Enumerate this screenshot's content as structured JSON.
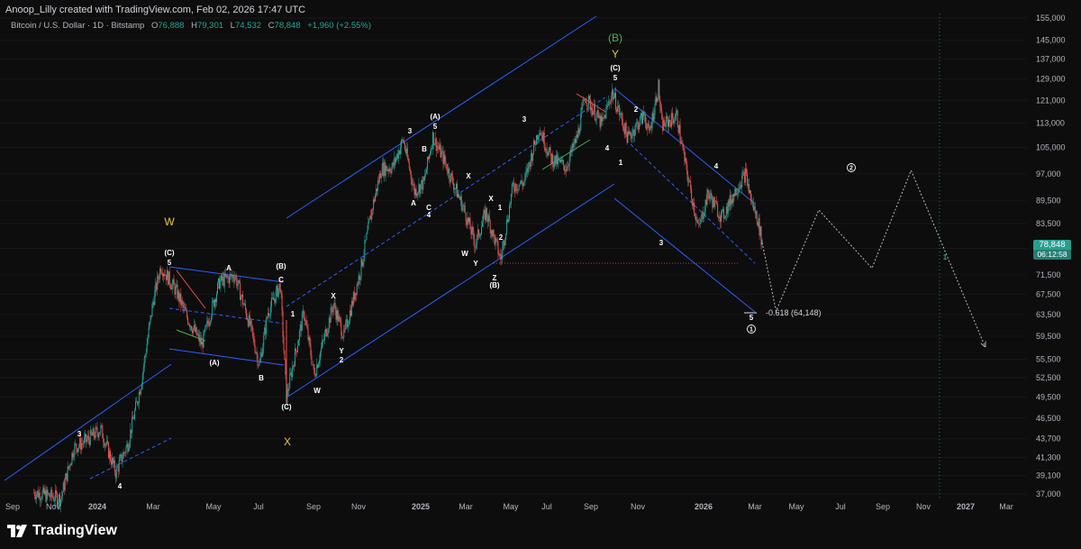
{
  "header": {
    "text": "Anoop_Lilly created with TradingView.com, Feb 02, 2026 17:47 UTC"
  },
  "symbol": {
    "name": "Bitcoin / U.S. Dollar · 1D · Bitstamp",
    "o_label": "O",
    "o": "76,888",
    "h_label": "H",
    "h": "79,301",
    "l_label": "L",
    "l": "74,532",
    "c_label": "C",
    "c": "78,848",
    "change": "+1,960 (+2.55%)"
  },
  "last_price": {
    "value": "78,848",
    "countdown": "06:12:58"
  },
  "fib_label": "-0.618 (64,148)",
  "footer": {
    "brand": "TradingView"
  },
  "colors": {
    "up": "#26a69a",
    "down": "#ef5350",
    "channel": "#2962ff",
    "wave_green": "#4caf50",
    "wave_yellow": "#e8c547",
    "background": "#0d0d0d"
  },
  "chart_data": {
    "type": "candlestick",
    "title": "Bitcoin / U.S. Dollar · 1D · Bitstamp",
    "y_axis_ticks": [
      "155,000",
      "145,000",
      "137,000",
      "129,000",
      "121,000",
      "113,000",
      "105,000",
      "97,000",
      "89,500",
      "83,500",
      "77,500",
      "71,500",
      "67,500",
      "63,500",
      "59,500",
      "55,500",
      "52,500",
      "49,500",
      "46,500",
      "43,700",
      "41,300",
      "39,100",
      "37,000"
    ],
    "x_axis_ticks": [
      "Sep",
      "Nov",
      "2024",
      "Mar",
      "May",
      "Jul",
      "Sep",
      "Nov",
      "2025",
      "Mar",
      "May",
      "Jul",
      "Sep",
      "Nov",
      "2026",
      "Mar",
      "May",
      "Jul",
      "Sep",
      "Nov",
      "2027",
      "Mar"
    ],
    "yscale": "log",
    "ylim": [
      37000,
      155000
    ],
    "close_path": [
      [
        "2023-10-20",
        37200
      ],
      [
        "2023-11-20",
        36500
      ],
      [
        "2023-12-05",
        42500
      ],
      [
        "2023-12-20",
        43500
      ],
      [
        "2024-01-05",
        45000
      ],
      [
        "2024-01-22",
        39500
      ],
      [
        "2024-02-05",
        43000
      ],
      [
        "2024-02-20",
        51500
      ],
      [
        "2024-03-05",
        66000
      ],
      [
        "2024-03-14",
        73500
      ],
      [
        "2024-04-01",
        68000
      ],
      [
        "2024-04-13",
        63000
      ],
      [
        "2024-04-30",
        58000
      ],
      [
        "2024-05-20",
        70000
      ],
      [
        "2024-06-07",
        71500
      ],
      [
        "2024-06-25",
        61000
      ],
      [
        "2024-07-05",
        54500
      ],
      [
        "2024-07-15",
        64000
      ],
      [
        "2024-07-29",
        69500
      ],
      [
        "2024-08-05",
        49500
      ],
      [
        "2024-08-25",
        64000
      ],
      [
        "2024-09-06",
        53000
      ],
      [
        "2024-09-28",
        65500
      ],
      [
        "2024-10-10",
        59500
      ],
      [
        "2024-10-29",
        72500
      ],
      [
        "2024-11-12",
        88000
      ],
      [
        "2024-11-22",
        98500
      ],
      [
        "2024-12-05",
        99000
      ],
      [
        "2024-12-17",
        107500
      ],
      [
        "2024-12-30",
        92000
      ],
      [
        "2025-01-10",
        94500
      ],
      [
        "2025-01-20",
        108500
      ],
      [
        "2025-02-03",
        100500
      ],
      [
        "2025-02-25",
        87000
      ],
      [
        "2025-03-10",
        78500
      ],
      [
        "2025-03-22",
        86500
      ],
      [
        "2025-04-08",
        75000
      ],
      [
        "2025-04-22",
        93500
      ],
      [
        "2025-05-05",
        94500
      ],
      [
        "2025-05-22",
        111500
      ],
      [
        "2025-06-05",
        101500
      ],
      [
        "2025-06-22",
        99000
      ],
      [
        "2025-07-05",
        108500
      ],
      [
        "2025-07-14",
        122500
      ],
      [
        "2025-08-02",
        112500
      ],
      [
        "2025-08-14",
        124000
      ],
      [
        "2025-09-01",
        108000
      ],
      [
        "2025-09-20",
        116000
      ],
      [
        "2025-09-25",
        109000
      ],
      [
        "2025-10-06",
        126000
      ],
      [
        "2025-10-10",
        112000
      ],
      [
        "2025-10-27",
        115500
      ],
      [
        "2025-11-05",
        101000
      ],
      [
        "2025-11-21",
        82000
      ],
      [
        "2025-12-02",
        91500
      ],
      [
        "2025-12-18",
        85000
      ],
      [
        "2026-01-05",
        93500
      ],
      [
        "2026-01-14",
        97000
      ],
      [
        "2026-01-21",
        89000
      ],
      [
        "2026-01-28",
        84500
      ],
      [
        "2026-02-02",
        78848
      ]
    ],
    "last_price": 78848,
    "projection": [
      [
        "2026-02-18",
        64148
      ],
      [
        "2026-04-08",
        87000
      ],
      [
        "2026-06-08",
        73000
      ],
      [
        "2026-07-23",
        98000
      ],
      [
        "2026-10-15",
        58000
      ]
    ],
    "annotations": [
      "W",
      "X",
      "Y",
      "(B)",
      "(A)",
      "(C)",
      "1",
      "2",
      "3",
      "4",
      "5",
      "A",
      "B",
      "C",
      "Z"
    ],
    "fib_level": {
      "label": "-0.618 (64,148)",
      "value": 64148
    }
  }
}
